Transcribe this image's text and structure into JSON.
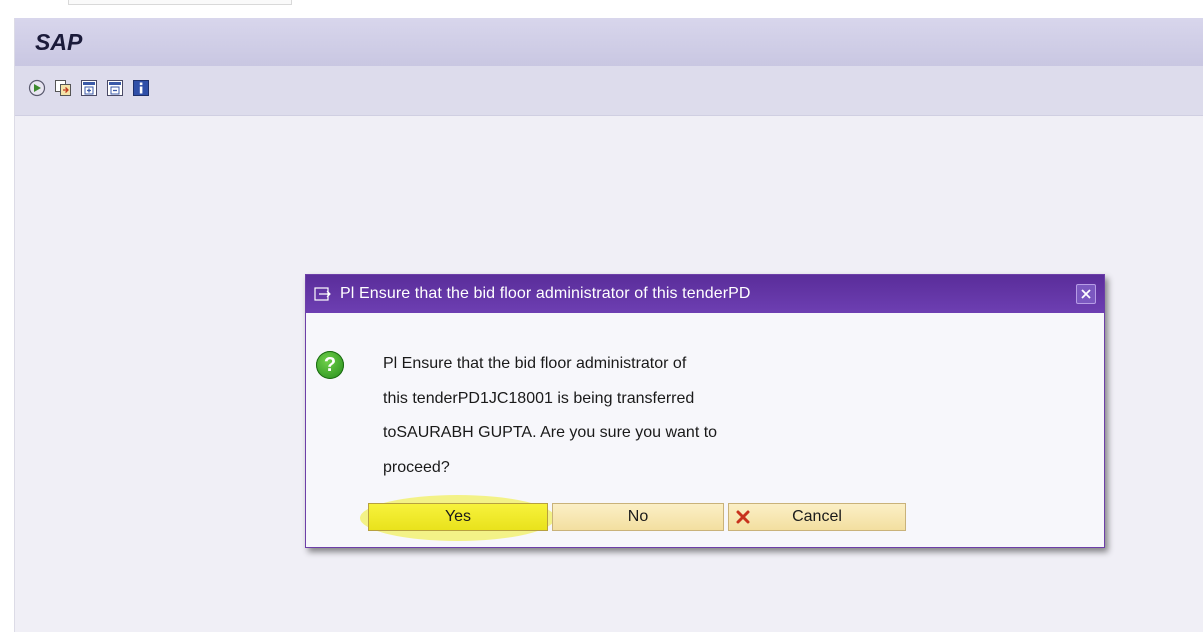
{
  "app": {
    "title": "SAP"
  },
  "toolbar": {
    "buttons": [
      {
        "icon": "execute-icon"
      },
      {
        "icon": "copy-icon"
      },
      {
        "icon": "expand-all-icon"
      },
      {
        "icon": "collapse-all-icon"
      },
      {
        "icon": "info-icon"
      }
    ]
  },
  "dialog": {
    "title": "Pl Ensure that the bid floor administrator of this tenderPD",
    "message_lines": [
      "Pl Ensure that the bid floor administrator of",
      "this tenderPD1JC18001 is being transferred",
      "toSAURABH GUPTA. Are you sure you want to",
      "proceed?"
    ],
    "buttons": {
      "yes": "Yes",
      "no": "No",
      "cancel": "Cancel"
    }
  },
  "colors": {
    "dialog_header": "#5a2d9a",
    "button_face": "#f3dfa0",
    "highlight": "#f0ee28",
    "title_bar": "#d8d6ec"
  }
}
